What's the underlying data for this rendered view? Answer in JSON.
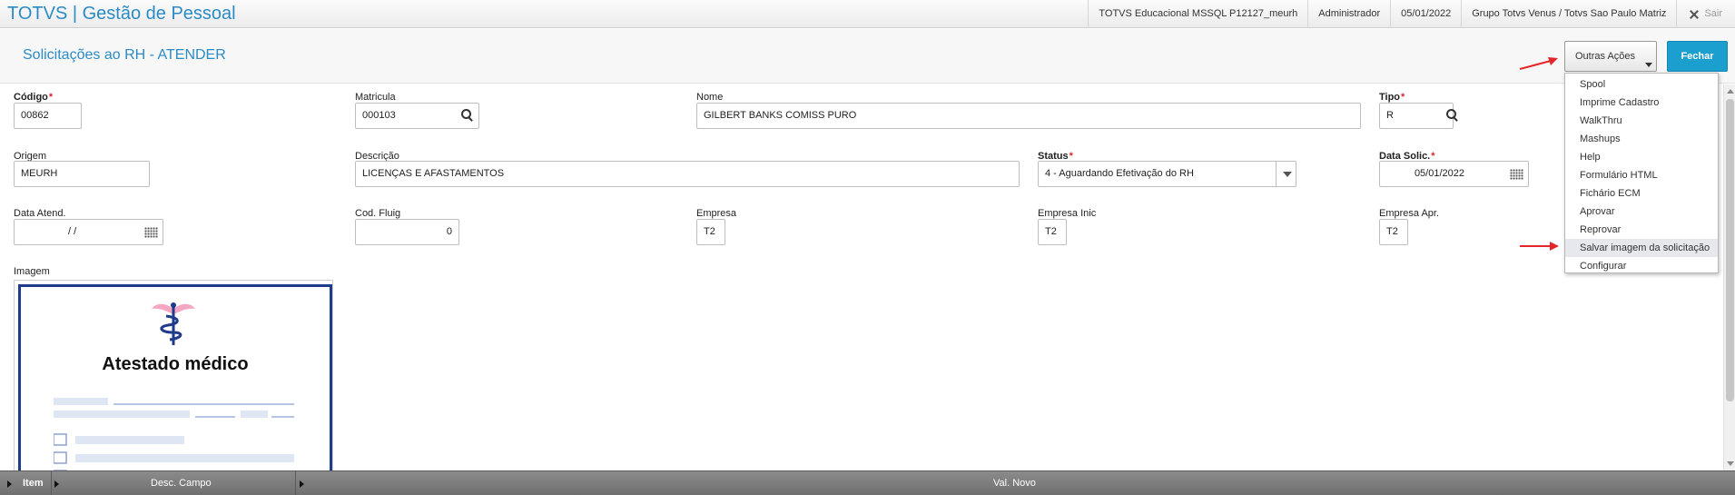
{
  "app": {
    "title": "TOTVS | Gestão de Pessoal",
    "environment": "TOTVS Educacional MSSQL P12127_meurh",
    "user": "Administrador",
    "date": "05/01/2022",
    "company": "Grupo Totvs Venus / Totvs Sao Paulo Matriz",
    "exit_label": "Sair"
  },
  "header": {
    "title": "Solicitações ao RH - ATENDER",
    "other_actions_label": "Outras Ações",
    "close_label": "Fechar"
  },
  "form": {
    "codigo": {
      "label": "Código",
      "value": "00862"
    },
    "matricula": {
      "label": "Matricula",
      "value": "000103"
    },
    "nome": {
      "label": "Nome",
      "value": "GILBERT BANKS COMISS PURO"
    },
    "tipo": {
      "label": "Tipo",
      "value": "R"
    },
    "origem": {
      "label": "Origem",
      "value": "MEURH"
    },
    "descricao": {
      "label": "Descrição",
      "value": "LICENÇAS E AFASTAMENTOS"
    },
    "status": {
      "label": "Status",
      "value": "4 - Aguardando Efetivação do RH"
    },
    "data_solic": {
      "label": "Data Solic.",
      "value": "05/01/2022"
    },
    "data_atend": {
      "label": "Data Atend.",
      "value": "/ /"
    },
    "cod_fluig": {
      "label": "Cod. Fluig",
      "value": "0"
    },
    "empresa": {
      "label": "Empresa",
      "value": "T2"
    },
    "empresa_inic": {
      "label": "Empresa Inic",
      "value": "T2"
    },
    "empresa_apr": {
      "label": "Empresa Apr.",
      "value": "T2"
    },
    "imagem": {
      "label": "Imagem",
      "document_title": "Atestado médico"
    }
  },
  "menu": {
    "items": [
      "Spool",
      "Imprime Cadastro",
      "WalkThru",
      "Mashups",
      "Help",
      "Formulário HTML",
      "Fichário ECM",
      "Aprovar",
      "Reprovar",
      "Salvar imagem da solicitação",
      "Configurar"
    ],
    "highlighted_index": 9
  },
  "grid": {
    "col_item": "Item",
    "col_desc": "Desc. Campo",
    "col_val": "Val. Novo"
  },
  "colors": {
    "accent": "#2b8bc6",
    "primary_button": "#1b9fcf",
    "required": "#d9262c",
    "annotation_arrow": "#e3262a"
  }
}
